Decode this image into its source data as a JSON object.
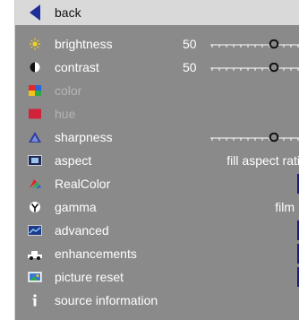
{
  "menu": {
    "back": "back",
    "brightness": {
      "label": "brightness",
      "value": "50",
      "level": 0.5
    },
    "contrast": {
      "label": "contrast",
      "value": "50",
      "level": 0.5
    },
    "color": {
      "label": "color"
    },
    "hue": {
      "label": "hue"
    },
    "sharpness": {
      "label": "sharpness",
      "level": 0.5
    },
    "aspect": {
      "label": "aspect",
      "value": "fill aspect rati"
    },
    "realcolor": {
      "label": "RealColor"
    },
    "gamma": {
      "label": "gamma",
      "value": "film"
    },
    "advanced": {
      "label": "advanced"
    },
    "enhancements": {
      "label": "enhancements"
    },
    "picture_reset": {
      "label": "picture reset"
    },
    "source_information": {
      "label": "source information"
    }
  },
  "colors": {
    "panel": "#8a8a8a",
    "header": "#d9d9d9",
    "back_arrow": "#1f2f9a",
    "disabled_text": "#b5b5b5",
    "edge_marker": "#1c1c7a"
  },
  "icons": {
    "back": "back-arrow-icon",
    "brightness": "sun-icon",
    "contrast": "contrast-icon",
    "color": "color-swatch-icon",
    "hue": "hue-icon",
    "sharpness": "sharpness-icon",
    "aspect": "aspect-icon",
    "realcolor": "realcolor-icon",
    "gamma": "gamma-icon",
    "advanced": "advanced-icon",
    "enhancements": "enhancements-icon",
    "picture_reset": "picture-reset-icon",
    "source_information": "info-icon"
  }
}
